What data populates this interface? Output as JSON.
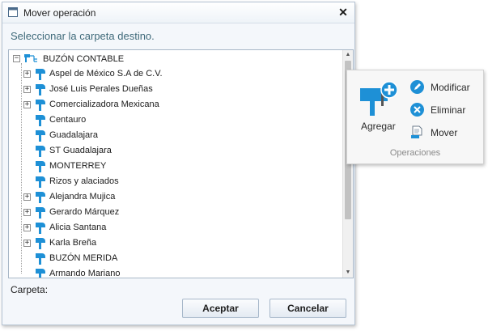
{
  "dialog": {
    "title": "Mover operación",
    "close_glyph": "✕",
    "instruction": "Seleccionar la carpeta destino.",
    "folder_label": "Carpeta:",
    "accept_label": "Aceptar",
    "cancel_label": "Cancelar"
  },
  "tree": {
    "root": {
      "label": "BUZÓN CONTABLE",
      "icon": "buzon-root-icon",
      "expanded": true
    },
    "items": [
      {
        "label": "Aspel de México S.A de C.V.",
        "expandable": true
      },
      {
        "label": "José Luis Perales Dueñas",
        "expandable": true
      },
      {
        "label": "Comercializadora Mexicana",
        "expandable": true
      },
      {
        "label": "Centauro",
        "expandable": false
      },
      {
        "label": "Guadalajara",
        "expandable": false
      },
      {
        "label": "ST Guadalajara",
        "expandable": false
      },
      {
        "label": "MONTERREY",
        "expandable": false
      },
      {
        "label": "Rizos y alaciados",
        "expandable": false
      },
      {
        "label": "Alejandra Mujica",
        "expandable": true
      },
      {
        "label": "Gerardo Márquez",
        "expandable": true
      },
      {
        "label": "Alicia Santana",
        "expandable": true
      },
      {
        "label": "Karla Breña",
        "expandable": true
      },
      {
        "label": "BUZÓN MERIDA",
        "expandable": false
      },
      {
        "label": "Armando Mariano",
        "expandable": false
      }
    ]
  },
  "ribbon": {
    "add_label": "Agregar",
    "modify_label": "Modificar",
    "delete_label": "Eliminar",
    "move_label": "Mover",
    "group_label": "Operaciones"
  },
  "colors": {
    "accent": "#1e90d6",
    "instruction_text": "#3f6a7a"
  }
}
